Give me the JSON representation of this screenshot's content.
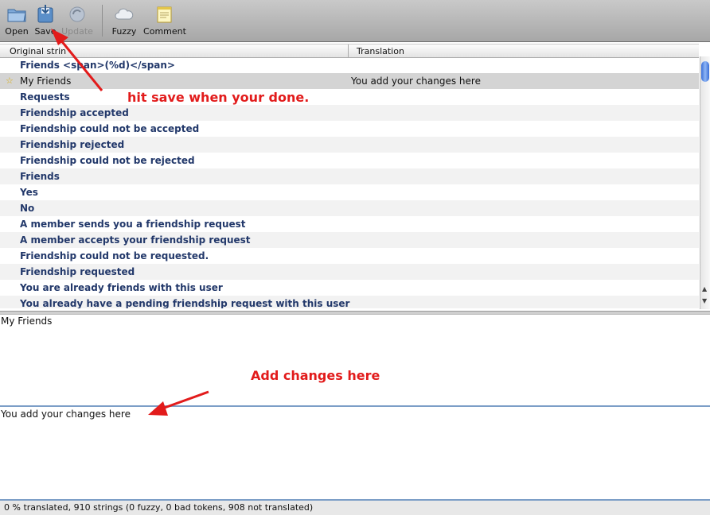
{
  "toolbar": {
    "open_label": "Open",
    "save_label": "Save",
    "update_label": "Update",
    "fuzzy_label": "Fuzzy",
    "comment_label": "Comment"
  },
  "table": {
    "col_original": "Original strin",
    "col_translation": "Translation",
    "rows": [
      {
        "original": "Friends <span>(%d)</span>",
        "translation": ""
      },
      {
        "original": "My Friends",
        "translation": "You add your changes here"
      },
      {
        "original": "Requests",
        "translation": ""
      },
      {
        "original": "Friendship accepted",
        "translation": ""
      },
      {
        "original": "Friendship could not be accepted",
        "translation": ""
      },
      {
        "original": "Friendship rejected",
        "translation": ""
      },
      {
        "original": "Friendship could not be rejected",
        "translation": ""
      },
      {
        "original": "Friends",
        "translation": ""
      },
      {
        "original": "Yes",
        "translation": ""
      },
      {
        "original": "No",
        "translation": ""
      },
      {
        "original": "A member sends you a friendship request",
        "translation": ""
      },
      {
        "original": "A member accepts your friendship request",
        "translation": ""
      },
      {
        "original": "Friendship could not be requested.",
        "translation": ""
      },
      {
        "original": "Friendship requested",
        "translation": ""
      },
      {
        "original": "You are already friends with this user",
        "translation": ""
      },
      {
        "original": "You already have a pending friendship request with this user",
        "translation": ""
      }
    ]
  },
  "original_pane": {
    "text": "My Friends"
  },
  "translation_pane": {
    "text": "You add your changes here"
  },
  "status": {
    "text": "0 % translated, 910 strings (0 fuzzy, 0 bad tokens, 908 not translated)"
  },
  "annotations": {
    "save_hint": "hit save when your done.",
    "changes_hint": "Add changes here"
  },
  "colors": {
    "annotation": "#e21b1b",
    "original_text": "#22386a",
    "selection": "#d4d4d4"
  }
}
